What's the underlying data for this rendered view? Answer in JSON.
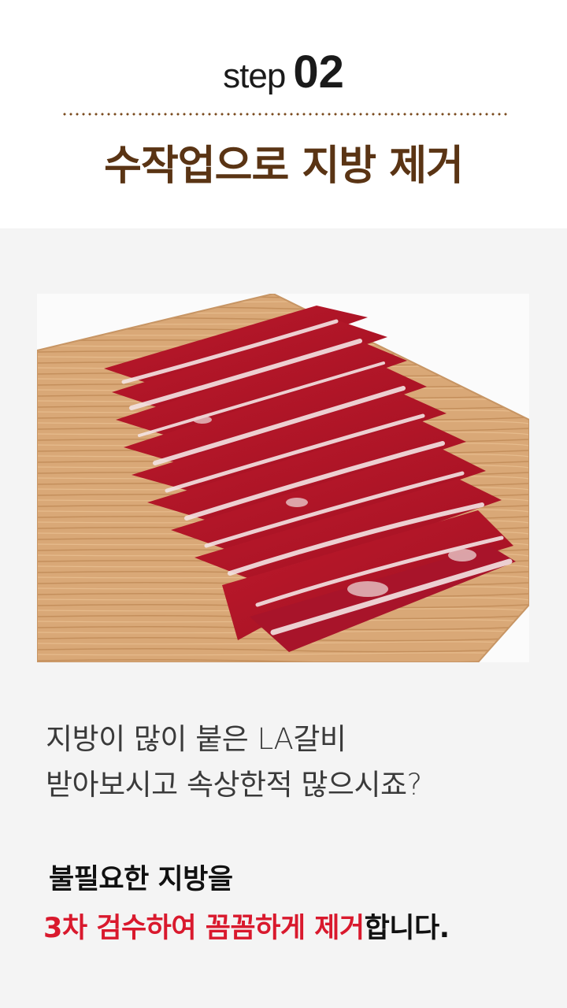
{
  "header": {
    "step_word": "step",
    "step_number": "02",
    "title": "수작업으로 지방 제거"
  },
  "description": {
    "line1": "지방이 많이 붙은 LA갈비",
    "line2": "받아보시고 속상한적 많으시죠?"
  },
  "emphasis": {
    "line1": "불필요한 지방을",
    "line2_red": "3차 검수하여 꼼꼼하게 제거",
    "line2_black": "합니다."
  },
  "colors": {
    "title_brown": "#5a3414",
    "accent_red": "#d9192d"
  }
}
